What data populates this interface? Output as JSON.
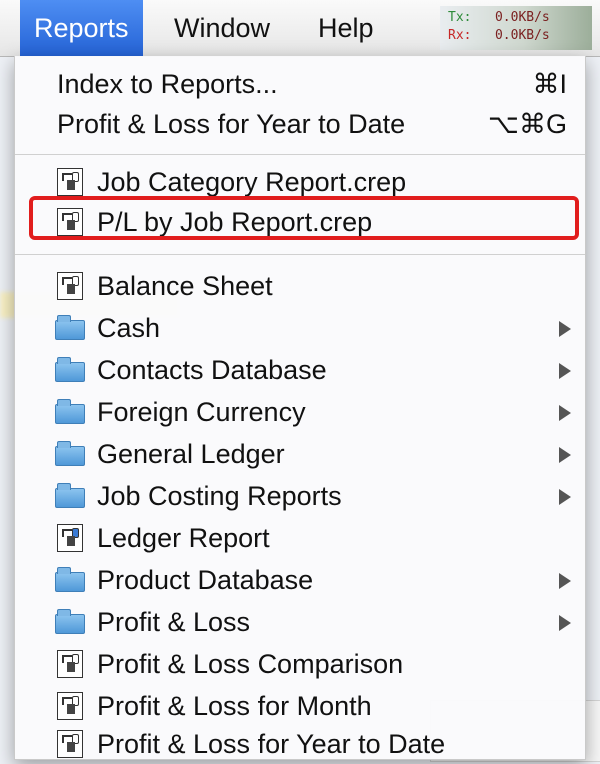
{
  "menubar": {
    "items": [
      {
        "label": "Reports",
        "active": true
      },
      {
        "label": "Window",
        "active": false
      },
      {
        "label": "Help",
        "active": false
      }
    ],
    "netmon": {
      "tx_label": "Tx:",
      "tx_value": "0.0KB/s",
      "rx_label": "Rx:",
      "rx_value": "0.0KB/s"
    }
  },
  "menu": {
    "index": {
      "label": "Index to Reports...",
      "shortcut": "⌘I"
    },
    "pl_ytd": {
      "label": "Profit & Loss for Year to Date",
      "shortcut": "⌥⌘G"
    },
    "custom": [
      {
        "label": "Job Category Report.crep",
        "icon": "report-doc-icon"
      },
      {
        "label": "P/L by Job Report.crep",
        "icon": "report-doc-icon",
        "highlighted": true
      }
    ],
    "reports": [
      {
        "label": "Balance Sheet",
        "icon": "report-doc-icon",
        "submenu": false
      },
      {
        "label": "Cash",
        "icon": "folder-icon",
        "submenu": true
      },
      {
        "label": "Contacts Database",
        "icon": "folder-icon",
        "submenu": true
      },
      {
        "label": "Foreign Currency",
        "icon": "folder-icon",
        "submenu": true
      },
      {
        "label": "General Ledger",
        "icon": "folder-icon",
        "submenu": true
      },
      {
        "label": "Job Costing Reports",
        "icon": "folder-icon",
        "submenu": true
      },
      {
        "label": "Ledger Report",
        "icon": "report-doc-icon",
        "submenu": false
      },
      {
        "label": "Product Database",
        "icon": "folder-icon",
        "submenu": true
      },
      {
        "label": "Profit & Loss",
        "icon": "folder-icon",
        "submenu": true
      },
      {
        "label": "Profit & Loss Comparison",
        "icon": "report-doc-icon",
        "submenu": false
      },
      {
        "label": "Profit & Loss for Month",
        "icon": "report-doc-icon",
        "submenu": false
      },
      {
        "label": "Profit & Loss for Year to Date",
        "icon": "report-doc-icon",
        "submenu": false
      }
    ]
  },
  "colors": {
    "accent": "#2f6fe0",
    "highlight_border": "#e11d1d"
  }
}
